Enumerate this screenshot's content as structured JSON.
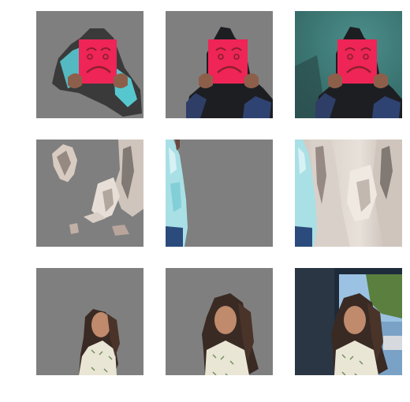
{
  "figure": {
    "rows": [
      {
        "row": "face-mask",
        "tiles": [
          {
            "kind": "masked-region",
            "subject": "person-holding-red-sad-face-sign",
            "background": "gray"
          },
          {
            "kind": "masked-region",
            "subject": "person-holding-red-sad-face-sign",
            "background": "gray"
          },
          {
            "kind": "original-photo",
            "subject": "person-holding-red-sad-face-sign",
            "background": "teal-wall"
          }
        ]
      },
      {
        "row": "tree-bark",
        "tiles": [
          {
            "kind": "masked-region",
            "subject": "tree-bark-fragments",
            "background": "gray"
          },
          {
            "kind": "masked-region",
            "subject": "person-in-light-blue-jacket",
            "background": "gray"
          },
          {
            "kind": "original-photo",
            "subject": "birch-tree-and-person",
            "background": "blurred-forest"
          }
        ]
      },
      {
        "row": "girl-portrait",
        "tiles": [
          {
            "kind": "masked-region",
            "subject": "girl-partial",
            "background": "gray"
          },
          {
            "kind": "masked-region",
            "subject": "girl-full",
            "background": "gray"
          },
          {
            "kind": "original-photo",
            "subject": "girl-at-window",
            "background": "dark-blue-wall"
          }
        ]
      }
    ],
    "colors": {
      "mask_gray": "#7f7f7f",
      "sign_red": "#e8224a",
      "teal_wall": "#3f7b78",
      "dark_wall": "#2a3644",
      "bark_light": "#d9d1c9",
      "jacket_blue": "#a9e0e6"
    }
  }
}
